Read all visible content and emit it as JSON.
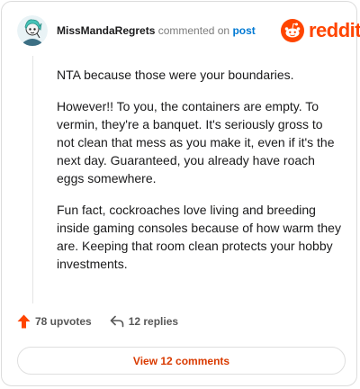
{
  "comment": {
    "author": "MissMandaRegrets",
    "action_text": "commented on",
    "target_link": "post",
    "paragraphs": [
      "NTA because those were your boundaries.",
      "However!! To you, the containers are empty. To vermin, they're a banquet. It's seriously gross to not clean that mess as you make it, even if it's the next day. Guaranteed, you already have roach eggs somewhere.",
      "Fun fact, cockroaches love living and breeding inside gaming consoles because of how warm they are. Keeping that room clean protects your hobby investments."
    ]
  },
  "brand": {
    "wordmark": "reddit",
    "color": "#ff4500"
  },
  "actions": {
    "upvotes": "78 upvotes",
    "replies": "12 replies"
  },
  "view_button": {
    "label": "View 12 comments"
  },
  "colors": {
    "accent": "#ff4500",
    "link": "#0079d3",
    "button_text": "#d93a00"
  }
}
